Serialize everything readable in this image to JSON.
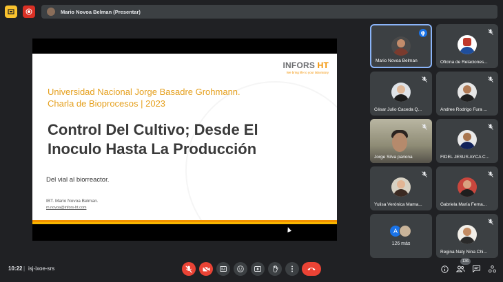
{
  "topbar": {
    "presenting_label": "Mario Novoa Belman (Presentar)"
  },
  "slide": {
    "logo_text_a": "INFORS ",
    "logo_text_b": "HT",
    "logo_slogan": "We bring life to your laboratory",
    "subtitle_line1": "Universidad Nacional Jorge Basadre Grohmann.",
    "subtitle_line2": "Charla de Bioprocesos | 2023",
    "title_line1": "Control Del Cultivo; Desde El",
    "title_line2": "Inoculo Hasta La Producción",
    "tagline": "Del vial al biorreactor.",
    "author": "IBT. Mario Novoa Belman.",
    "email": "m.novoa@infors-ht.com"
  },
  "participants": [
    {
      "name": "Mario Novoa Belman",
      "speaking": true
    },
    {
      "name": "Oficina de Relaciones...",
      "speaking": false
    },
    {
      "name": "César Julio Caceda Q...",
      "speaking": false
    },
    {
      "name": "Andree Rodrigo Fura ...",
      "speaking": false
    },
    {
      "name": "Jorge Silva pariona",
      "speaking": false
    },
    {
      "name": "FIDEL JESUS AYCA C...",
      "speaking": false
    },
    {
      "name": "Yulisa Verónica Mama...",
      "speaking": false
    },
    {
      "name": "Gabriela María Ferna...",
      "speaking": false
    },
    {
      "more_initial": "A",
      "more_label": "126 más"
    },
    {
      "name": "Regina Naty Nina Chi...",
      "speaking": false
    }
  ],
  "bottombar": {
    "time": "10:22",
    "separator": "|",
    "meeting_code": "isj-ixoe-srs",
    "participant_count": "136"
  },
  "colors": {
    "background": "#202124",
    "tile": "#3c4043",
    "accent_blue": "#1a73e8",
    "danger_red": "#ea4335",
    "brand_orange": "#f39200"
  }
}
